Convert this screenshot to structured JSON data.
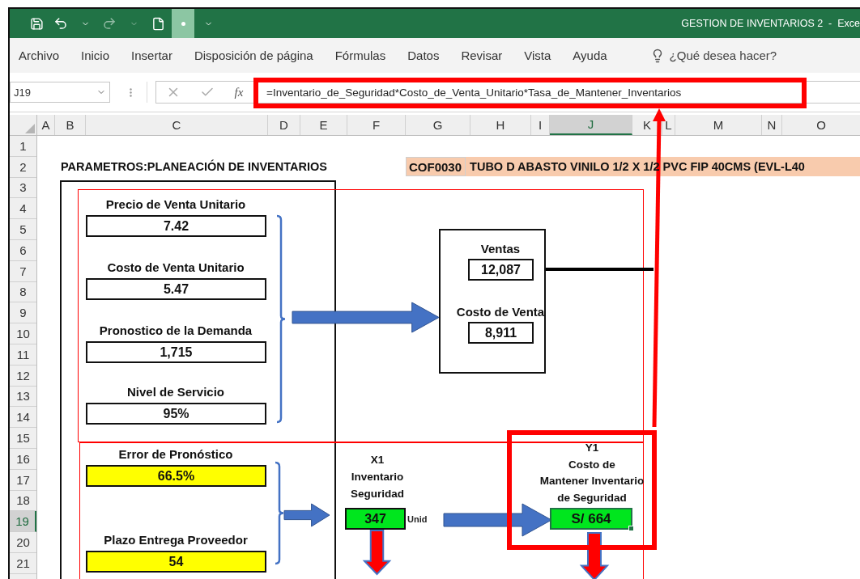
{
  "window": {
    "title": "GESTION DE INVENTARIOS 2  -  Exce"
  },
  "menu": [
    "Archivo",
    "Inicio",
    "Insertar",
    "Disposición de página",
    "Fórmulas",
    "Datos",
    "Revisar",
    "Vista",
    "Ayuda"
  ],
  "tell_me": {
    "placeholder": "¿Qué desea hacer?"
  },
  "formula_bar": {
    "name_box": "J19",
    "fx": "fx",
    "formula": "=Inventario_de_Seguridad*Costo_de_Venta_Unitario*Tasa_de_Mantener_Inventarios"
  },
  "columns": [
    {
      "label": "A",
      "selected": false
    },
    {
      "label": "B",
      "selected": false
    },
    {
      "label": "C",
      "selected": false
    },
    {
      "label": "D",
      "selected": false
    },
    {
      "label": "E",
      "selected": false
    },
    {
      "label": "F",
      "selected": false
    },
    {
      "label": "G",
      "selected": false
    },
    {
      "label": "H",
      "selected": false
    },
    {
      "label": "I",
      "selected": false
    },
    {
      "label": "J",
      "selected": true
    },
    {
      "label": "K",
      "selected": false
    },
    {
      "label": "L",
      "selected": false
    },
    {
      "label": "M",
      "selected": false
    },
    {
      "label": "N",
      "selected": false
    },
    {
      "label": "O",
      "selected": false
    }
  ],
  "rows": [
    {
      "label": "1",
      "selected": false
    },
    {
      "label": "2",
      "selected": false
    },
    {
      "label": "3",
      "selected": false
    },
    {
      "label": "4",
      "selected": false
    },
    {
      "label": "5",
      "selected": false
    },
    {
      "label": "6",
      "selected": false
    },
    {
      "label": "7",
      "selected": false
    },
    {
      "label": "8",
      "selected": false
    },
    {
      "label": "9",
      "selected": false
    },
    {
      "label": "10",
      "selected": false
    },
    {
      "label": "11",
      "selected": false
    },
    {
      "label": "12",
      "selected": false
    },
    {
      "label": "13",
      "selected": false
    },
    {
      "label": "14",
      "selected": false
    },
    {
      "label": "15",
      "selected": false
    },
    {
      "label": "16",
      "selected": false
    },
    {
      "label": "17",
      "selected": false
    },
    {
      "label": "18",
      "selected": false
    },
    {
      "label": "19",
      "selected": true
    },
    {
      "label": "20",
      "selected": false
    },
    {
      "label": "21",
      "selected": false
    }
  ],
  "sheet": {
    "title": "PARAMETROS:PLANEACIÓN DE INVENTARIOS",
    "product": {
      "code": "COF0030",
      "description": "TUBO D ABASTO VINILO 1/2 X 1/2 PVC FIP 40CMS (EVL-L40"
    },
    "inputs": [
      {
        "label": "Precio de Venta Unitario",
        "value": "7.42",
        "kind": "plain"
      },
      {
        "label": "Costo de Venta Unitario",
        "value": "5.47",
        "kind": "plain"
      },
      {
        "label": "Pronostico de la Demanda",
        "value": "1,715",
        "kind": "plain"
      },
      {
        "label": "Nivel de Servicio",
        "value": "95%",
        "kind": "plain"
      },
      {
        "label": "Error de Pronóstico",
        "value": "66.5%",
        "kind": "highlighted"
      },
      {
        "label": "Plazo Entrega Proveedor",
        "value": "54",
        "kind": "highlighted"
      }
    ],
    "results": [
      {
        "label": "Ventas",
        "value": "12,087"
      },
      {
        "label": "Costo de Venta",
        "value": "8,911"
      }
    ],
    "safety_stock": {
      "lines": [
        "X1",
        "Inventario",
        "Seguridad"
      ],
      "value": "347",
      "unit": "Unid"
    },
    "holding_cost": {
      "lines": [
        "Y1",
        "Costo de",
        "Mantener Inventario",
        "de Seguridad"
      ],
      "value": "S/ 664",
      "selected": true
    }
  }
}
